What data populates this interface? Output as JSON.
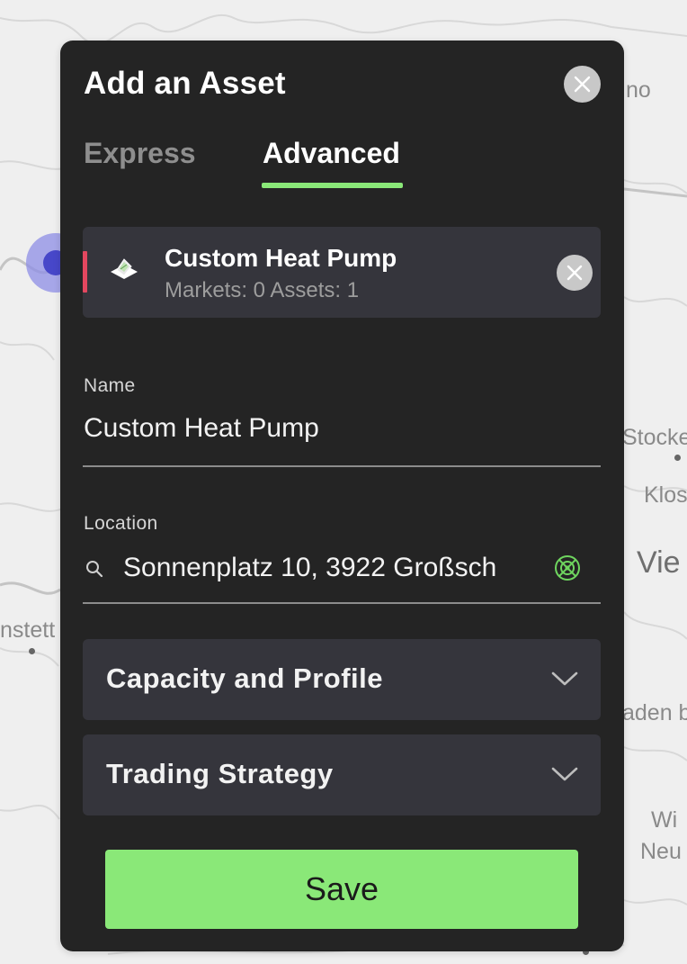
{
  "map": {
    "labels": [
      "no",
      "Stocke",
      "Klos",
      "Vie",
      "nstett",
      "aden b",
      "Wi",
      "Neu"
    ]
  },
  "dialog": {
    "title": "Add an Asset",
    "tabs": [
      {
        "label": "Express",
        "active": false
      },
      {
        "label": "Advanced",
        "active": true
      }
    ],
    "asset_card": {
      "title": "Custom Heat Pump",
      "subtitle": "Markets: 0 Assets: 1",
      "accent_color": "#e3475f"
    },
    "name_field": {
      "label": "Name",
      "value": "Custom Heat Pump"
    },
    "location_field": {
      "label": "Location",
      "value": "Sonnenplatz 10, 3922 Großsch"
    },
    "sections": [
      {
        "label": "Capacity and Profile",
        "icon": "chevron-down-icon"
      },
      {
        "label": "Trading Strategy",
        "icon": "chevron-down-icon"
      }
    ],
    "save_label": "Save"
  },
  "colors": {
    "accent_green": "#8ae878",
    "dialog_bg": "#242424",
    "card_bg": "#35353c",
    "accent_red": "#e3475f"
  }
}
